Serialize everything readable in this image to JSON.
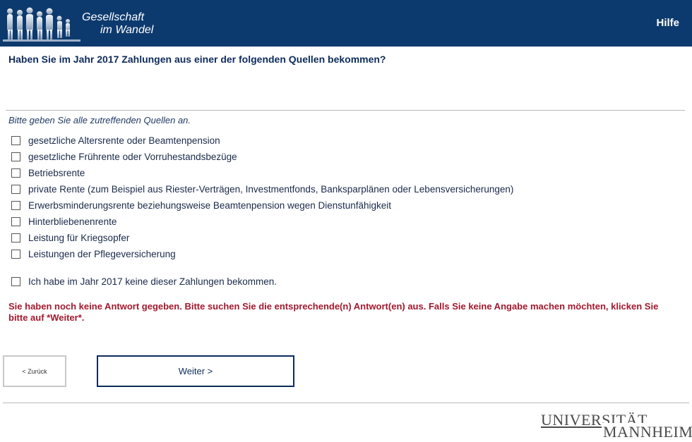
{
  "header": {
    "logo_line1": "Gesellschaft",
    "logo_line2": "im Wandel",
    "help_label": "Hilfe",
    "background_color": "#0d3a6e"
  },
  "question": {
    "title": "Haben Sie im Jahr 2017 Zahlungen aus einer der folgenden Quellen bekommen?",
    "instruction": "Bitte geben Sie alle zutreffenden Quellen an."
  },
  "options": [
    {
      "label": "gesetzliche Altersrente oder Beamtenpension",
      "checked": false
    },
    {
      "label": "gesetzliche Frührente oder Vorruhestandsbezüge",
      "checked": false
    },
    {
      "label": "Betriebsrente",
      "checked": false
    },
    {
      "label": "private Rente (zum Beispiel aus Riester-Verträgen, Investmentfonds, Banksparplänen oder Lebensversicherungen)",
      "checked": false
    },
    {
      "label": "Erwerbsminderungsrente beziehungsweise Beamtenpension wegen Dienstunfähigkeit",
      "checked": false
    },
    {
      "label": "Hinterbliebenenrente",
      "checked": false
    },
    {
      "label": "Leistung für Kriegsopfer",
      "checked": false
    },
    {
      "label": "Leistungen der Pflegeversicherung",
      "checked": false
    }
  ],
  "none_option": {
    "label": "Ich habe im Jahr 2017 keine dieser Zahlungen bekommen.",
    "checked": false
  },
  "error_message": "Sie haben noch keine Antwort gegeben. Bitte suchen Sie die entsprechende(n) Antwort(en) aus. Falls Sie keine Angabe machen möchten, klicken Sie bitte auf *Weiter*.",
  "navigation": {
    "back_label": "< Zurück",
    "next_label": "Weiter >"
  },
  "footer": {
    "university_line1": "UNIVERSITÄT",
    "university_line2": "MANNHEIM"
  },
  "colors": {
    "error": "#a3182e",
    "question_text": "#0d2b5a"
  }
}
